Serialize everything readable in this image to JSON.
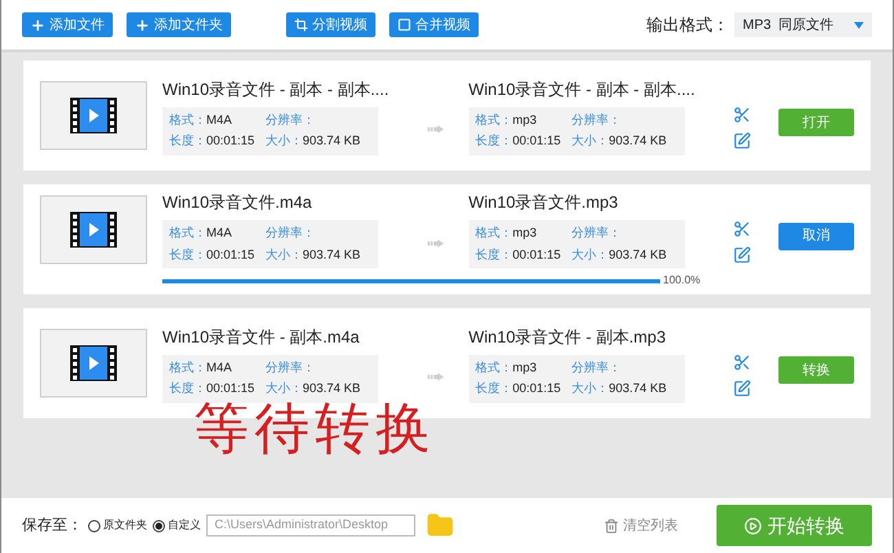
{
  "toolbar": {
    "buttons": [
      {
        "label": "添加文件",
        "kind": "plus"
      },
      {
        "label": "添加文件夹",
        "kind": "plus"
      },
      {
        "label": "分割视频",
        "kind": "split"
      },
      {
        "label": "合并视频",
        "kind": "merge"
      }
    ],
    "format_label": "输出格式：",
    "format_value": "MP3  同原文件"
  },
  "files": [
    {
      "source": {
        "name": "Win10录音文件 - 副本 - 副本....",
        "format_label": "格式：",
        "format": "M4A",
        "resolution_label": "分辨率：",
        "duration_label": "长度：",
        "duration": "00:01:15",
        "size_label": "大小：",
        "size": "903.74 KB"
      },
      "target": {
        "name": "Win10录音文件 - 副本 - 副本....",
        "format_label": "格式：",
        "format": "mp3",
        "resolution_label": "分辨率：",
        "duration_label": "长度：",
        "duration": "00:01:15",
        "size_label": "大小：",
        "size": "903.74 KB"
      },
      "action": {
        "label": "打开",
        "kind": "open"
      }
    },
    {
      "source": {
        "name": "Win10录音文件.m4a",
        "format_label": "格式：",
        "format": "M4A",
        "resolution_label": "分辨率：",
        "duration_label": "长度：",
        "duration": "00:01:15",
        "size_label": "大小：",
        "size": "903.74 KB"
      },
      "target": {
        "name": "Win10录音文件.mp3",
        "format_label": "格式：",
        "format": "mp3",
        "resolution_label": "分辨率：",
        "duration_label": "长度：",
        "duration": "00:01:15",
        "size_label": "大小：",
        "size": "903.74 KB"
      },
      "action": {
        "label": "取消",
        "kind": "cancel"
      },
      "progress": {
        "level": 1,
        "reading": "100.0%"
      }
    },
    {
      "source": {
        "name": "Win10录音文件 - 副本.m4a",
        "format_label": "格式：",
        "format": "M4A",
        "resolution_label": "分辨率：",
        "duration_label": "长度：",
        "duration": "00:01:15",
        "size_label": "大小：",
        "size": "903.74 KB"
      },
      "target": {
        "name": "Win10录音文件 - 副本.mp3",
        "format_label": "格式：",
        "format": "mp3",
        "resolution_label": "分辨率：",
        "duration_label": "长度：",
        "duration": "00:01:15",
        "size_label": "大小：",
        "size": "903.74 KB"
      },
      "action": {
        "label": "转换",
        "kind": "convert"
      }
    }
  ],
  "annotation": "等待转换",
  "footer": {
    "save_label": "保存至：",
    "options": [
      {
        "label": "原文件夹",
        "selected": false
      },
      {
        "label": "自定义",
        "selected": true
      }
    ],
    "path": "C:\\Users\\Administrator\\Desktop",
    "clear_label": "清空列表",
    "start_label": "开始转换"
  }
}
